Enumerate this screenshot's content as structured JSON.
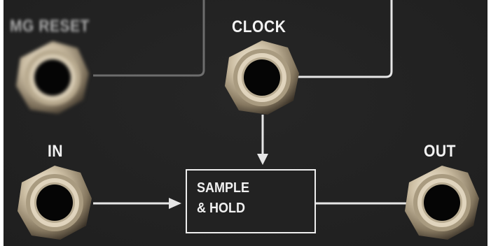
{
  "panel": {
    "labels": {
      "mg_reset": "MG RESET",
      "clock": "CLOCK",
      "in": "IN",
      "out": "OUT"
    },
    "module": {
      "line1": "SAMPLE",
      "line2": "& HOLD"
    }
  },
  "colors": {
    "panel_background": "#222222",
    "wire": "#e6e6e6",
    "label_text": "#f3f3f3",
    "jack_ring": "#c9bca3",
    "jack_hole": "#050505"
  },
  "icons": {
    "jack": "jack-socket-icon",
    "arrow": "arrow-head-icon"
  }
}
